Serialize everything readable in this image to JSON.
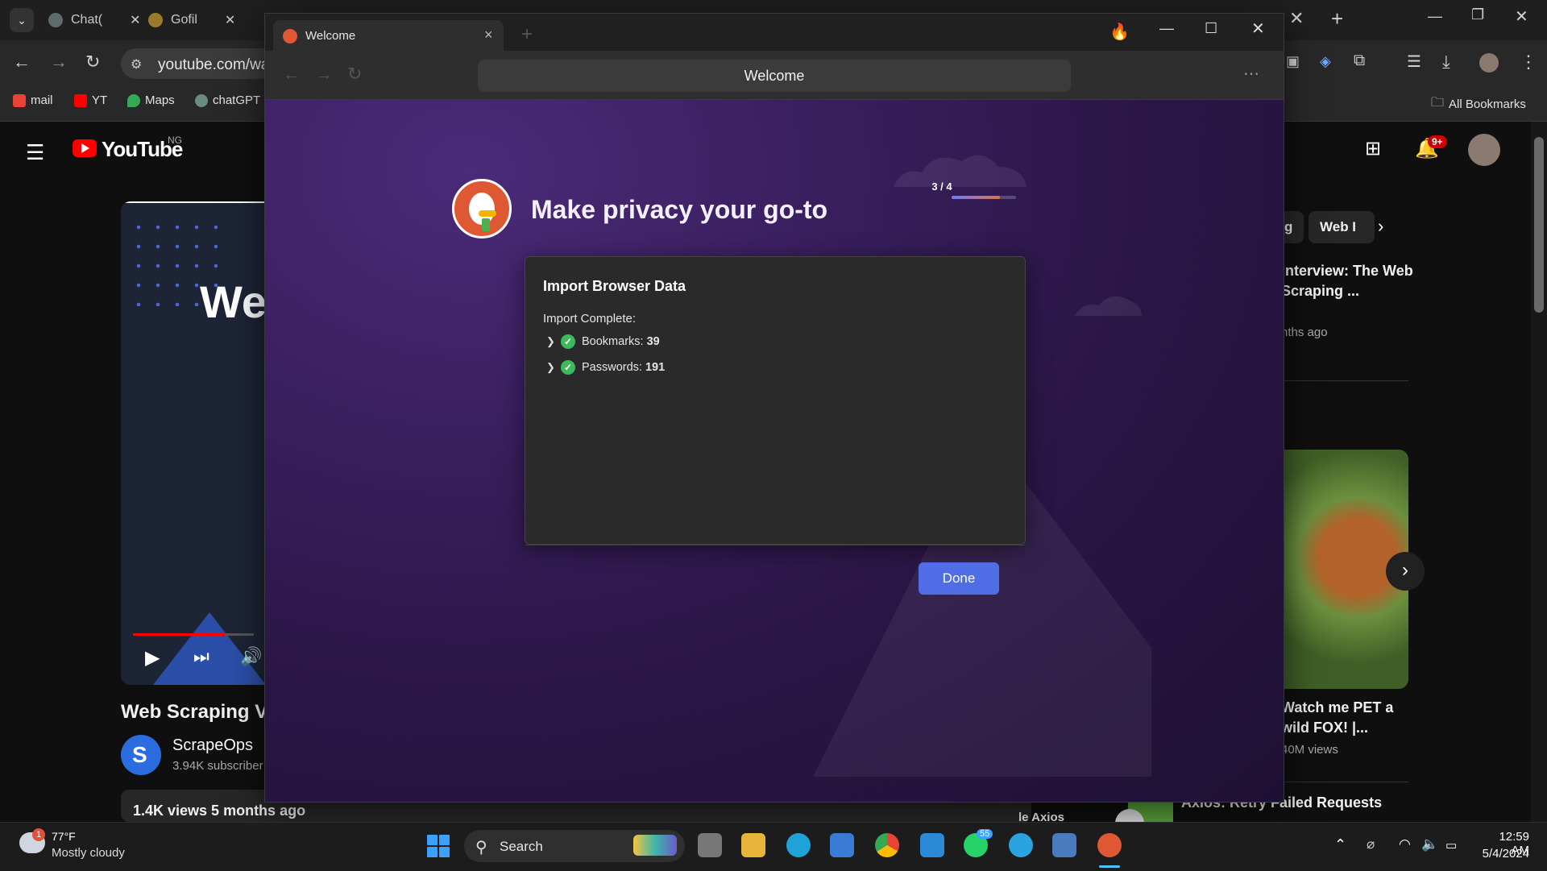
{
  "chrome": {
    "tabs": [
      {
        "label": "Chat("
      },
      {
        "label": "Gofil"
      }
    ],
    "url": "youtube.com/wat",
    "bookmarks": [
      "mail",
      "YT",
      "Maps",
      "chatGPT"
    ],
    "all_bookmarks": "All Bookmarks"
  },
  "youtube": {
    "logo_text": "YouTube",
    "region": "NG",
    "video_title": "Web Scraping V",
    "thumb_text": "We",
    "channel_name": "ScrapeOps",
    "channel_subs": "3.94K subscriber",
    "views_line": "1.4K views  5 months ago",
    "notif_count": "9+",
    "chips": [
      "g",
      "Web I"
    ],
    "side_items": [
      {
        "title": "Interview: The Web Scraping ...",
        "meta": "nths ago"
      },
      {
        "title": "Watch me PET a wild FOX! |...",
        "meta": "40M views"
      },
      {
        "title": "Axios: Retry Failed Requests",
        "meta": ""
      }
    ],
    "side_extra_title": "le Axios"
  },
  "ddg": {
    "tab_title": "Welcome",
    "address": "Welcome",
    "heading": "Make privacy your go-to",
    "progress_label": "3 / 4",
    "progress_fraction": 0.75,
    "dialog": {
      "title": "Import Browser Data",
      "status": "Import Complete:",
      "results": [
        {
          "label": "Bookmarks:",
          "count": "39"
        },
        {
          "label": "Passwords:",
          "count": "191"
        }
      ],
      "done_label": "Done"
    }
  },
  "taskbar": {
    "weather_temp": "77°F",
    "weather_desc": "Mostly cloudy",
    "weather_badge": "1",
    "search_label": "Search",
    "whatsapp_badge": "55",
    "time": "12:59 AM",
    "date": "5/4/2024"
  },
  "colors": {
    "accent_blue": "#4f6ee6",
    "ddg_orange": "#de5833",
    "check_green": "#3bba5b",
    "yt_red": "#ff0000"
  }
}
